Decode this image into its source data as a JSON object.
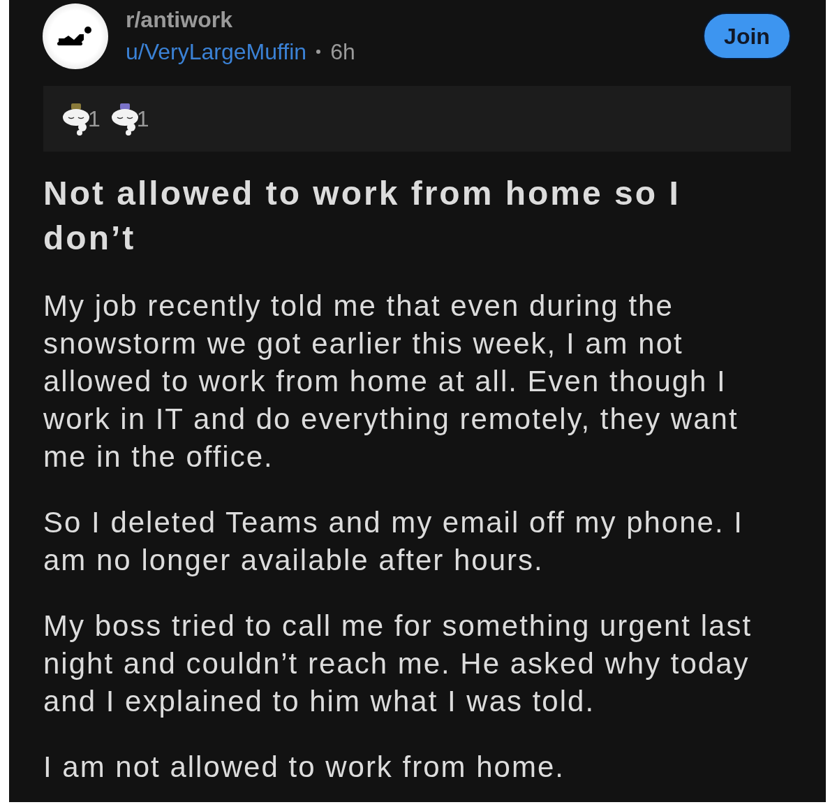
{
  "post": {
    "subreddit": "r/antiwork",
    "author": "u/VeryLargeMuffin",
    "age": "6h",
    "join_label": "Join",
    "awards": [
      {
        "count": "1",
        "color": "#8a7a3a"
      },
      {
        "count": "1",
        "color": "#7a72c8"
      }
    ],
    "title": "Not allowed to work from home so I don’t",
    "paragraphs": [
      "My job recently told me that even during the snowstorm we got earlier this week, I am not allowed to work from home at all. Even though I work in IT and do everything remotely, they want me in the office.",
      "So I deleted Teams and my email off my phone. I am no longer available after hours.",
      "My boss tried to call me for something urgent last night and couldn’t reach me. He asked why today and I explained to him what I was told.",
      "I am not allowed to work from home."
    ]
  }
}
